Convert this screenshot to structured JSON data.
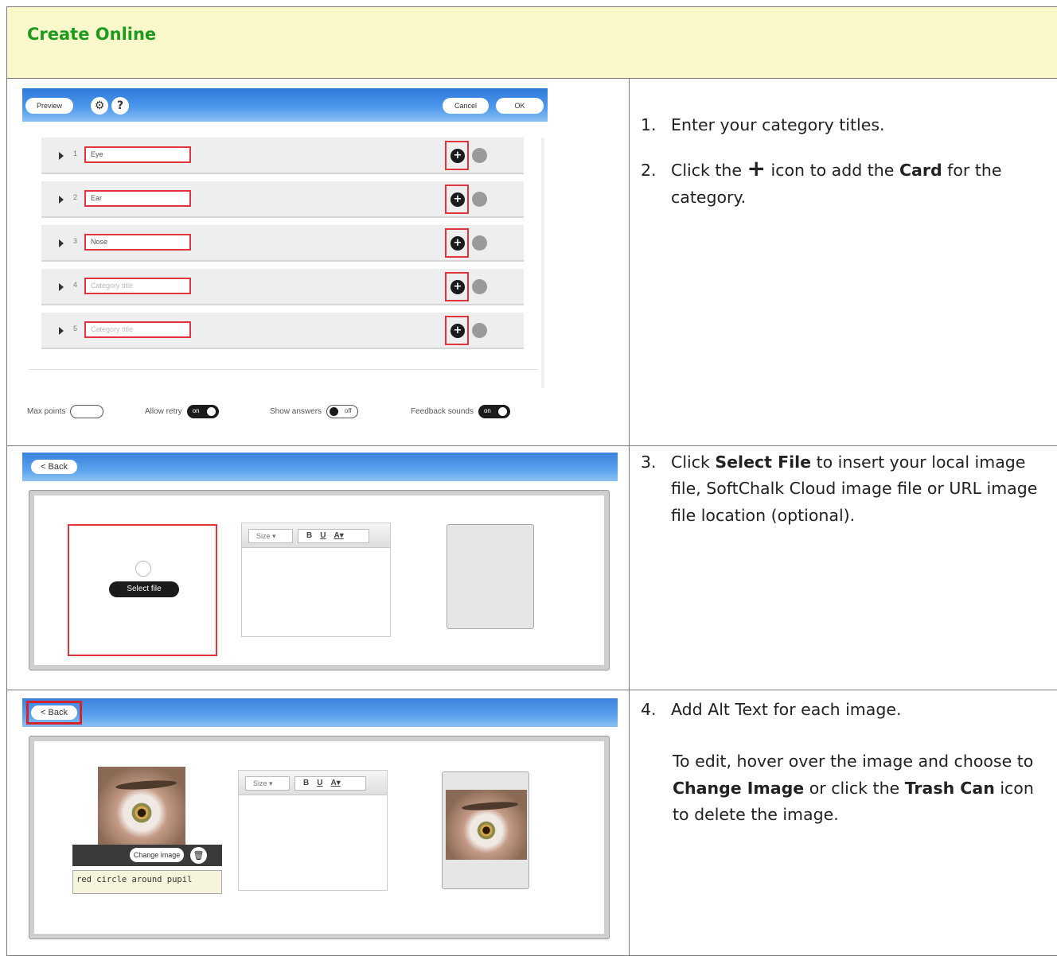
{
  "header": {
    "title": "Create Online"
  },
  "shot1": {
    "toolbar": {
      "preview": "Preview",
      "settings_icon": "gear-icon",
      "help_icon": "?",
      "cancel": "Cancel",
      "ok": "OK"
    },
    "rows": [
      {
        "num": "1",
        "value": "Eye",
        "placeholder": false
      },
      {
        "num": "2",
        "value": "Ear",
        "placeholder": false
      },
      {
        "num": "3",
        "value": "Nose",
        "placeholder": false
      },
      {
        "num": "4",
        "value": "Category title",
        "placeholder": true
      },
      {
        "num": "5",
        "value": "Category title",
        "placeholder": true
      }
    ],
    "options": {
      "max_points": "Max points",
      "allow_retry": "Allow retry",
      "allow_retry_state": "on",
      "show_answers": "Show answers",
      "show_answers_state": "off",
      "feedback_sounds": "Feedback sounds",
      "feedback_sounds_state": "on"
    }
  },
  "shot2": {
    "back": "< Back",
    "select_file": "Select file",
    "editor": {
      "size": "Size",
      "bold": "B",
      "underline": "U",
      "color": "A"
    }
  },
  "shot3": {
    "back": "< Back",
    "change_image": "Change image",
    "alt_text": "red circle around pupil",
    "editor": {
      "size": "Size",
      "bold": "B",
      "underline": "U",
      "color": "A"
    }
  },
  "steps": {
    "s1": {
      "num": "1.",
      "text": "Enter your category titles."
    },
    "s2": {
      "num": "2.",
      "pre": "Click the",
      "icon": "+",
      "mid": "icon to add the",
      "bold": "Card",
      "post": "for the category."
    },
    "s3": {
      "num": "3.",
      "pre": "Click",
      "bold": "Select File",
      "post": "to insert your local image file, SoftChalk Cloud image file or URL image file location (optional)."
    },
    "s4": {
      "num": "4.",
      "text": "Add Alt Text for each image.",
      "p_pre": "To edit, hover over the image and choose to",
      "p_bold1": "Change Image",
      "p_mid": "or click the",
      "p_bold2": "Trash Can",
      "p_post": "icon to delete the image."
    }
  }
}
